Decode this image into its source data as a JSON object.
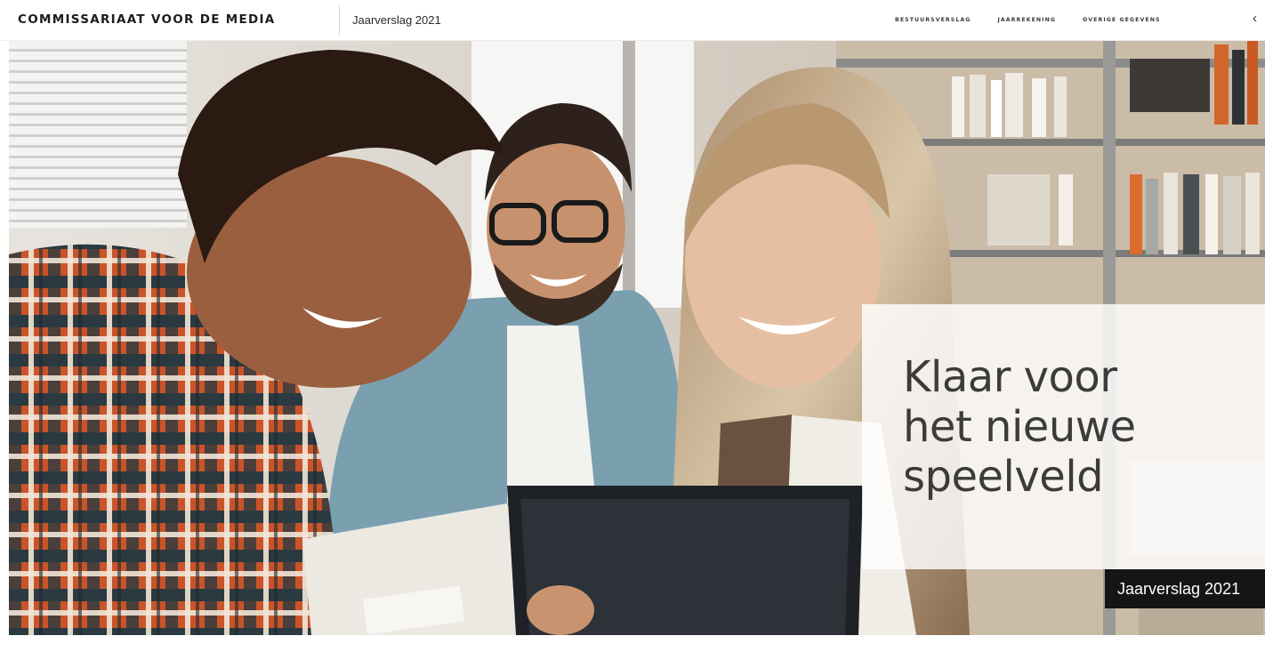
{
  "header": {
    "brand": "COMMISSARIAAT VOOR DE MEDIA",
    "report_title": "Jaarverslag 2021",
    "nav": [
      {
        "label": "BESTUURSVERSLAG"
      },
      {
        "label": "JAARREKENING"
      },
      {
        "label": "OVERIGE GEGEVENS"
      }
    ],
    "arrow_icon": "chevron-left-icon"
  },
  "hero": {
    "headline": [
      "Klaar voor",
      "het nieuwe",
      "speelveld"
    ],
    "badge": "Jaarverslag 2021"
  },
  "colors": {
    "text": "#1c1c1c",
    "badge_bg": "#151515",
    "panel_bg": "#ffffff"
  }
}
